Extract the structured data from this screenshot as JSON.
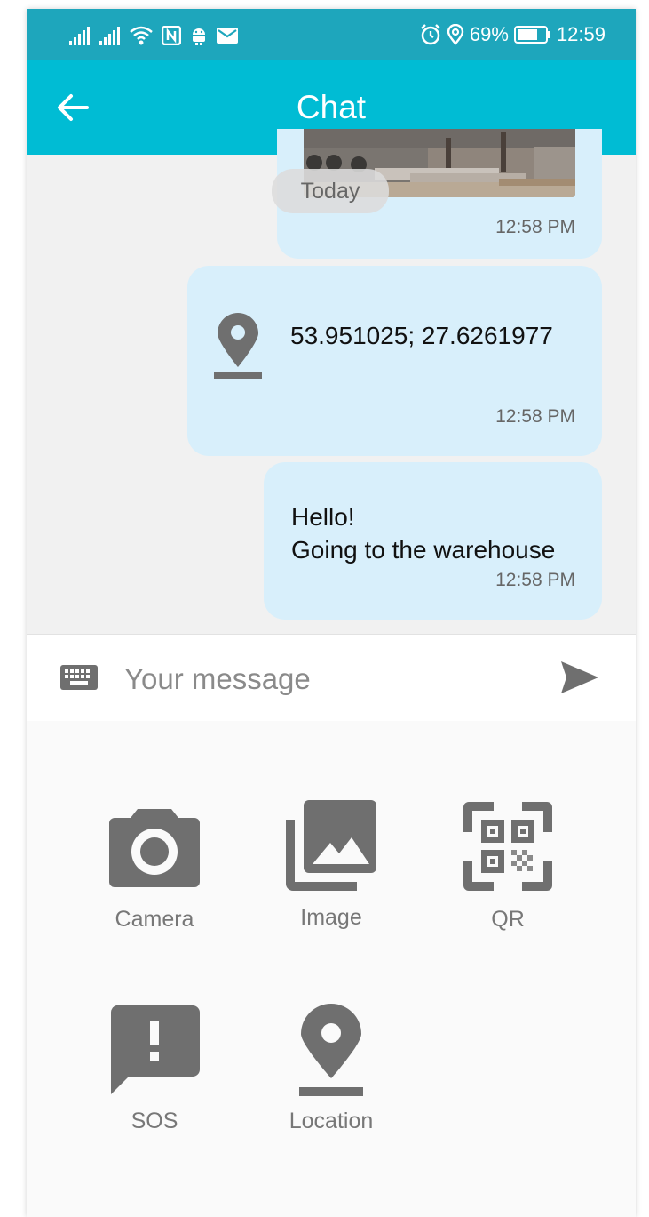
{
  "status_bar": {
    "battery": "69%",
    "time": "12:59"
  },
  "app_bar": {
    "title": "Chat"
  },
  "messages": {
    "date_chip": "Today",
    "image_message": {
      "time": "12:58 PM"
    },
    "location_message": {
      "coords": "53.951025; 27.6261977",
      "time": "12:58 PM"
    },
    "text_message": {
      "text": "Hello!\nGoing to the warehouse",
      "time": "12:58 PM"
    }
  },
  "composer": {
    "placeholder": "Your message"
  },
  "attachments": [
    {
      "label": "Camera",
      "icon": "camera-icon"
    },
    {
      "label": "Image",
      "icon": "image-icon"
    },
    {
      "label": "QR",
      "icon": "qr-icon"
    },
    {
      "label": "SOS",
      "icon": "sos-icon"
    },
    {
      "label": "Location",
      "icon": "location-icon"
    }
  ],
  "colors": {
    "status_bar": "#1ea6bc",
    "app_bar": "#00bcd4",
    "bubble": "#d8effb",
    "icon_gray": "#6f6f6f"
  }
}
